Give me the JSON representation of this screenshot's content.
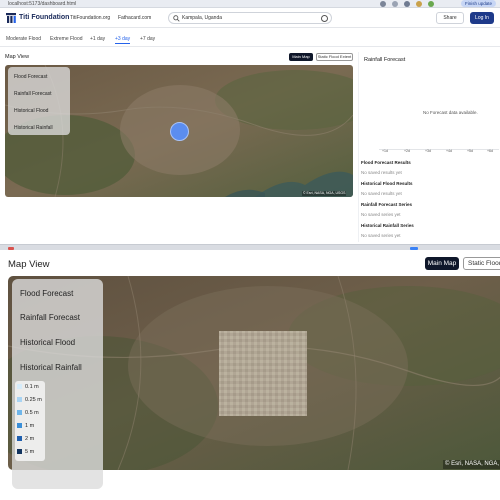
{
  "browser": {
    "url": "localhost:5173/dashboard.html",
    "update_label": "Finish update"
  },
  "header": {
    "brand": "Titi Foundation",
    "links": [
      "TitiFoundation.org",
      "Fathacard.com"
    ],
    "search_value": "Kampala, Uganda",
    "share_label": "Share",
    "login_label": "Log In"
  },
  "tabs": [
    {
      "label": "Moderate Flood"
    },
    {
      "label": "Extreme Flood"
    },
    {
      "label": "+1 day"
    },
    {
      "label": "+3 day"
    },
    {
      "label": "+7 day"
    }
  ],
  "map_small": {
    "title": "Map View",
    "main_map_label": "Main Map",
    "static_label": "Static Flood Extent",
    "legend": [
      "Flood Forecast",
      "Rainfall Forecast",
      "Historical Flood",
      "Historical Rainfall"
    ],
    "attribution": "© Esri, NASA, NGA, USGS"
  },
  "forecast_panel": {
    "title": "Rainfall Forecast",
    "no_data": "No Forecast data available.",
    "ticks": [
      "+1d",
      "+2d",
      "+3d",
      "+4d",
      "+5d",
      "+6d"
    ],
    "sections": [
      {
        "title": "Flood Forecast Results",
        "sub": "No saved results yet"
      },
      {
        "title": "Historical Flood Results",
        "sub": "No saved results yet"
      },
      {
        "title": "Rainfall Forecast Series",
        "sub": "No saved series yet"
      },
      {
        "title": "Historical Rainfall Series",
        "sub": "No saved series yet"
      }
    ]
  },
  "map_large": {
    "title": "Map View",
    "main_map_label": "Main Map",
    "static_label": "Static Flood Extent",
    "legend": [
      "Flood Forecast",
      "Rainfall Forecast",
      "Historical Flood",
      "Historical Rainfall"
    ],
    "depth_scale": [
      {
        "label": "0.1 m",
        "color": "#d6ecfa"
      },
      {
        "label": "0.25 m",
        "color": "#a9d4f3"
      },
      {
        "label": "0.5 m",
        "color": "#6fb6ea"
      },
      {
        "label": "1 m",
        "color": "#3a8fd8"
      },
      {
        "label": "2 m",
        "color": "#1f5fae"
      },
      {
        "label": "5 m",
        "color": "#12345f"
      }
    ],
    "attribution": "© Esri, NASA, NGA, USGS"
  },
  "colors": {
    "accent": "#2563eb",
    "primary_button": "#1e3a8a",
    "dark_button": "#0f172a",
    "location_marker": "#5b8def"
  }
}
